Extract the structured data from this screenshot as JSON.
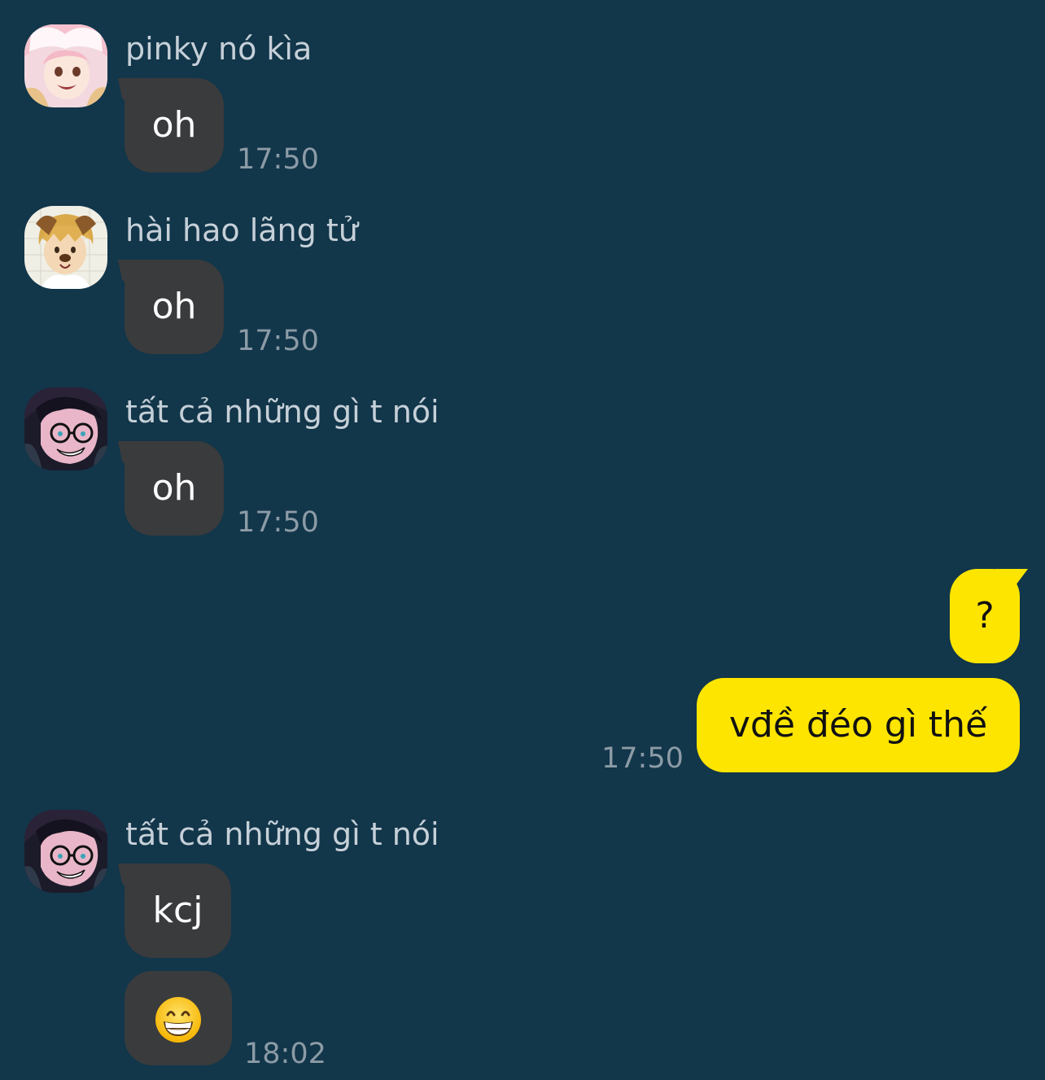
{
  "messages": [
    {
      "sender": "pinky nó kìa",
      "avatar_icon": "avatar-pink-anime-girl-icon",
      "text": "oh",
      "time": "17:50"
    },
    {
      "sender": "hài hao lãng tử",
      "avatar_icon": "avatar-dog-ears-boy-icon",
      "text": "oh",
      "time": "17:50"
    },
    {
      "sender": "tất cả những gì t nói",
      "avatar_icon": "avatar-glasses-boy-icon",
      "text": "oh",
      "time": "17:50"
    }
  ],
  "outgoing": [
    {
      "text": "?"
    },
    {
      "text": "vđề đéo gì thế",
      "time": "17:50"
    }
  ],
  "last_group": {
    "sender": "tất cả những gì t nói",
    "avatar_icon": "avatar-glasses-boy-icon",
    "text": "kcj",
    "emoji_icon": "grinning-face-emoji-icon",
    "time": "18:02"
  },
  "colors": {
    "background": "#12364a",
    "incoming_bubble": "#3a3b3d",
    "outgoing_bubble": "#fee500",
    "sender_text": "#c6d0d8",
    "time_text": "#8c9ba6"
  }
}
